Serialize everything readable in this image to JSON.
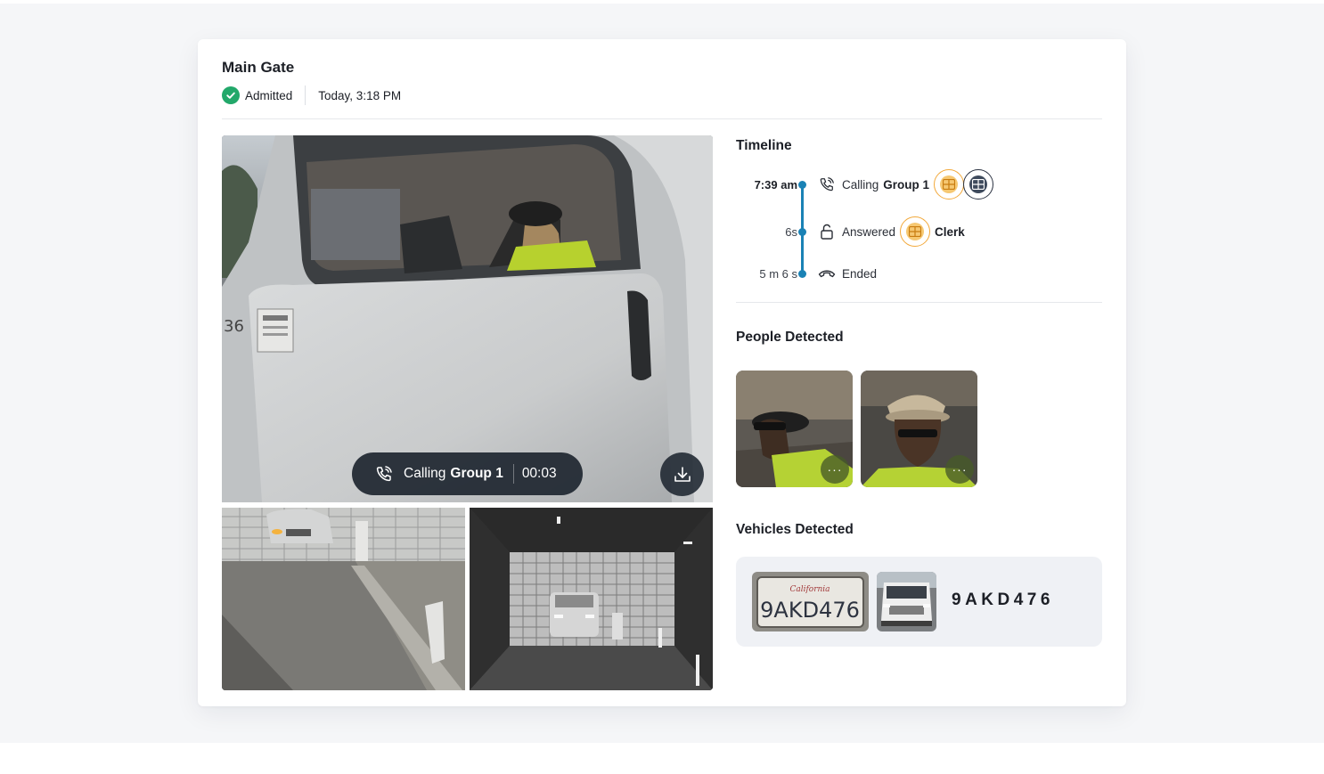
{
  "event": {
    "title": "Main Gate",
    "status": "Admitted",
    "datetime": "Today, 3:18 PM"
  },
  "main_camera": {
    "call_label": "Calling",
    "call_group": "Group 1",
    "call_timer": "00:03"
  },
  "timeline": {
    "title": "Timeline",
    "events": [
      {
        "time": "7:39 am",
        "label": "Calling",
        "target": "Group 1",
        "icon": "phone-ringing-icon"
      },
      {
        "time": "6s",
        "label": "Answered",
        "target": "Clerk",
        "icon": "unlock-icon"
      },
      {
        "time": "5 m 6 s",
        "label": "Ended",
        "target": "",
        "icon": "hang-up-icon"
      }
    ]
  },
  "people": {
    "title": "People Detected",
    "more_label": "···"
  },
  "vehicles": {
    "title": "Vehicles Detected",
    "plate": "9AKD476",
    "plate_on_image": "9AKD476",
    "plate_state_on_image": "California"
  },
  "colors": {
    "accent_blue": "#1a82b5",
    "success_green": "#22a86a",
    "amber": "#f2a93b",
    "dark_pill": "#1e2630"
  }
}
